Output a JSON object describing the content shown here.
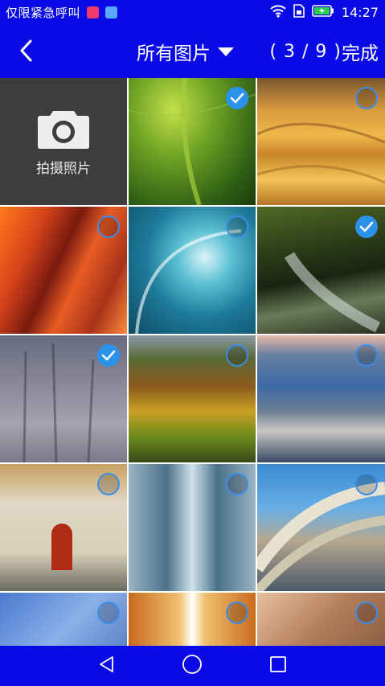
{
  "status_bar": {
    "carrier": "仅限紧急呼叫",
    "time": "14:27",
    "icons": [
      "notification-app-icon",
      "notification-contact-icon",
      "wifi-icon",
      "sim-icon",
      "battery-charging-icon"
    ]
  },
  "header": {
    "back_icon": "chevron-left-icon",
    "album_label": "所有图片",
    "selection_count": "( 3 / 9 )",
    "done_label": "完成"
  },
  "grid": {
    "camera_tile_label": "拍摄照片",
    "photos": [
      {
        "name": "green-leaf",
        "selected": true
      },
      {
        "name": "desert-dunes",
        "selected": false
      },
      {
        "name": "red-canyon",
        "selected": false
      },
      {
        "name": "ocean-wave",
        "selected": false
      },
      {
        "name": "mossy-waterfall",
        "selected": true
      },
      {
        "name": "misty-trees",
        "selected": true
      },
      {
        "name": "autumn-hills",
        "selected": false
      },
      {
        "name": "lake-driftwood",
        "selected": false
      },
      {
        "name": "red-door-house",
        "selected": false
      },
      {
        "name": "glass-corridor",
        "selected": false
      },
      {
        "name": "curved-building",
        "selected": false
      },
      {
        "name": "blue-metal-building",
        "selected": false
      },
      {
        "name": "escalator-tunnel",
        "selected": false
      },
      {
        "name": "interior-geometry",
        "selected": false
      }
    ]
  },
  "nav_bar": {
    "icons": [
      "back-triangle-icon",
      "home-circle-icon",
      "recents-square-icon"
    ]
  },
  "colors": {
    "bar_blue": "#0a0ae6",
    "check_blue": "#2b92ea",
    "camera_tile": "#3c3d3d"
  }
}
